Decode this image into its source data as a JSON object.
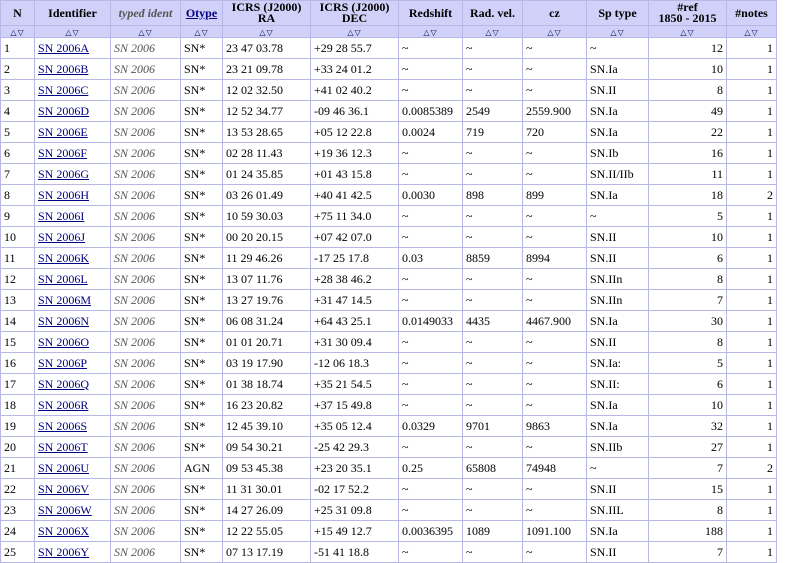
{
  "headers": {
    "n": "N",
    "identifier": "Identifier",
    "typed": "typed ident",
    "otype": "Otype",
    "ra_top": "ICRS (J2000)",
    "ra_sub": "RA",
    "dec_top": "ICRS (J2000)",
    "dec_sub": "DEC",
    "redshift": "Redshift",
    "radvel": "Rad. vel.",
    "cz": "cz",
    "sptype": "Sp type",
    "ref_top": "#ref",
    "ref_sub": "1850 - 2015",
    "notes": "#notes",
    "sort_glyph": "△▽"
  },
  "rows": [
    {
      "n": "1",
      "id": "SN 2006A",
      "typed": "SN 2006",
      "otype": "SN*",
      "ra": "23 47 03.78",
      "dec": "+29 28 55.7",
      "z": "~",
      "rv": "~",
      "cz": "~",
      "sp": "~",
      "ref": "12",
      "notes": "1"
    },
    {
      "n": "2",
      "id": "SN 2006B",
      "typed": "SN 2006",
      "otype": "SN*",
      "ra": "23 21 09.78",
      "dec": "+33 24 01.2",
      "z": "~",
      "rv": "~",
      "cz": "~",
      "sp": "SN.Ia",
      "ref": "10",
      "notes": "1"
    },
    {
      "n": "3",
      "id": "SN 2006C",
      "typed": "SN 2006",
      "otype": "SN*",
      "ra": "12 02 32.50",
      "dec": "+41 02 40.2",
      "z": "~",
      "rv": "~",
      "cz": "~",
      "sp": "SN.II",
      "ref": "8",
      "notes": "1"
    },
    {
      "n": "4",
      "id": "SN 2006D",
      "typed": "SN 2006",
      "otype": "SN*",
      "ra": "12 52 34.77",
      "dec": "-09 46 36.1",
      "z": "0.0085389",
      "rv": "2549",
      "cz": "2559.900",
      "sp": "SN.Ia",
      "ref": "49",
      "notes": "1"
    },
    {
      "n": "5",
      "id": "SN 2006E",
      "typed": "SN 2006",
      "otype": "SN*",
      "ra": "13 53 28.65",
      "dec": "+05 12 22.8",
      "z": "0.0024",
      "rv": "719",
      "cz": "720",
      "sp": "SN.Ia",
      "ref": "22",
      "notes": "1"
    },
    {
      "n": "6",
      "id": "SN 2006F",
      "typed": "SN 2006",
      "otype": "SN*",
      "ra": "02 28 11.43",
      "dec": "+19 36 12.3",
      "z": "~",
      "rv": "~",
      "cz": "~",
      "sp": "SN.Ib",
      "ref": "16",
      "notes": "1"
    },
    {
      "n": "7",
      "id": "SN 2006G",
      "typed": "SN 2006",
      "otype": "SN*",
      "ra": "01 24 35.85",
      "dec": "+01 43 15.8",
      "z": "~",
      "rv": "~",
      "cz": "~",
      "sp": "SN.II/IIb",
      "ref": "11",
      "notes": "1"
    },
    {
      "n": "8",
      "id": "SN 2006H",
      "typed": "SN 2006",
      "otype": "SN*",
      "ra": "03 26 01.49",
      "dec": "+40 41 42.5",
      "z": "0.0030",
      "rv": "898",
      "cz": "899",
      "sp": "SN.Ia",
      "ref": "18",
      "notes": "2"
    },
    {
      "n": "9",
      "id": "SN 2006I",
      "typed": "SN 2006",
      "otype": "SN*",
      "ra": "10 59 30.03",
      "dec": "+75 11 34.0",
      "z": "~",
      "rv": "~",
      "cz": "~",
      "sp": "~",
      "ref": "5",
      "notes": "1"
    },
    {
      "n": "10",
      "id": "SN 2006J",
      "typed": "SN 2006",
      "otype": "SN*",
      "ra": "00 20 20.15",
      "dec": "+07 42 07.0",
      "z": "~",
      "rv": "~",
      "cz": "~",
      "sp": "SN.II",
      "ref": "10",
      "notes": "1"
    },
    {
      "n": "11",
      "id": "SN 2006K",
      "typed": "SN 2006",
      "otype": "SN*",
      "ra": "11 29 46.26",
      "dec": "-17 25 17.8",
      "z": "0.03",
      "rv": "8859",
      "cz": "8994",
      "sp": "SN.II",
      "ref": "6",
      "notes": "1"
    },
    {
      "n": "12",
      "id": "SN 2006L",
      "typed": "SN 2006",
      "otype": "SN*",
      "ra": "13 07 11.76",
      "dec": "+28 38 46.2",
      "z": "~",
      "rv": "~",
      "cz": "~",
      "sp": "SN.IIn",
      "ref": "8",
      "notes": "1"
    },
    {
      "n": "13",
      "id": "SN 2006M",
      "typed": "SN 2006",
      "otype": "SN*",
      "ra": "13 27 19.76",
      "dec": "+31 47 14.5",
      "z": "~",
      "rv": "~",
      "cz": "~",
      "sp": "SN.IIn",
      "ref": "7",
      "notes": "1"
    },
    {
      "n": "14",
      "id": "SN 2006N",
      "typed": "SN 2006",
      "otype": "SN*",
      "ra": "06 08 31.24",
      "dec": "+64 43 25.1",
      "z": "0.0149033",
      "rv": "4435",
      "cz": "4467.900",
      "sp": "SN.Ia",
      "ref": "30",
      "notes": "1"
    },
    {
      "n": "15",
      "id": "SN 2006O",
      "typed": "SN 2006",
      "otype": "SN*",
      "ra": "01 01 20.71",
      "dec": "+31 30 09.4",
      "z": "~",
      "rv": "~",
      "cz": "~",
      "sp": "SN.II",
      "ref": "8",
      "notes": "1"
    },
    {
      "n": "16",
      "id": "SN 2006P",
      "typed": "SN 2006",
      "otype": "SN*",
      "ra": "03 19 17.90",
      "dec": "-12 06 18.3",
      "z": "~",
      "rv": "~",
      "cz": "~",
      "sp": "SN.Ia:",
      "ref": "5",
      "notes": "1"
    },
    {
      "n": "17",
      "id": "SN 2006Q",
      "typed": "SN 2006",
      "otype": "SN*",
      "ra": "01 38 18.74",
      "dec": "+35 21 54.5",
      "z": "~",
      "rv": "~",
      "cz": "~",
      "sp": "SN.II:",
      "ref": "6",
      "notes": "1"
    },
    {
      "n": "18",
      "id": "SN 2006R",
      "typed": "SN 2006",
      "otype": "SN*",
      "ra": "16 23 20.82",
      "dec": "+37 15 49.8",
      "z": "~",
      "rv": "~",
      "cz": "~",
      "sp": "SN.Ia",
      "ref": "10",
      "notes": "1"
    },
    {
      "n": "19",
      "id": "SN 2006S",
      "typed": "SN 2006",
      "otype": "SN*",
      "ra": "12 45 39.10",
      "dec": "+35 05 12.4",
      "z": "0.0329",
      "rv": "9701",
      "cz": "9863",
      "sp": "SN.Ia",
      "ref": "32",
      "notes": "1"
    },
    {
      "n": "20",
      "id": "SN 2006T",
      "typed": "SN 2006",
      "otype": "SN*",
      "ra": "09 54 30.21",
      "dec": "-25 42 29.3",
      "z": "~",
      "rv": "~",
      "cz": "~",
      "sp": "SN.IIb",
      "ref": "27",
      "notes": "1"
    },
    {
      "n": "21",
      "id": "SN 2006U",
      "typed": "SN 2006",
      "otype": "AGN",
      "ra": "09 53 45.38",
      "dec": "+23 20 35.1",
      "z": "0.25",
      "rv": "65808",
      "cz": "74948",
      "sp": "~",
      "ref": "7",
      "notes": "2"
    },
    {
      "n": "22",
      "id": "SN 2006V",
      "typed": "SN 2006",
      "otype": "SN*",
      "ra": "11 31 30.01",
      "dec": "-02 17 52.2",
      "z": "~",
      "rv": "~",
      "cz": "~",
      "sp": "SN.II",
      "ref": "15",
      "notes": "1"
    },
    {
      "n": "23",
      "id": "SN 2006W",
      "typed": "SN 2006",
      "otype": "SN*",
      "ra": "14 27 26.09",
      "dec": "+25 31 09.8",
      "z": "~",
      "rv": "~",
      "cz": "~",
      "sp": "SN.IIL",
      "ref": "8",
      "notes": "1"
    },
    {
      "n": "24",
      "id": "SN 2006X",
      "typed": "SN 2006",
      "otype": "SN*",
      "ra": "12 22 55.05",
      "dec": "+15 49 12.7",
      "z": "0.0036395",
      "rv": "1089",
      "cz": "1091.100",
      "sp": "SN.Ia",
      "ref": "188",
      "notes": "1"
    },
    {
      "n": "25",
      "id": "SN 2006Y",
      "typed": "SN 2006",
      "otype": "SN*",
      "ra": "07 13 17.19",
      "dec": "-51 41 18.8",
      "z": "~",
      "rv": "~",
      "cz": "~",
      "sp": "SN.II",
      "ref": "7",
      "notes": "1"
    }
  ]
}
